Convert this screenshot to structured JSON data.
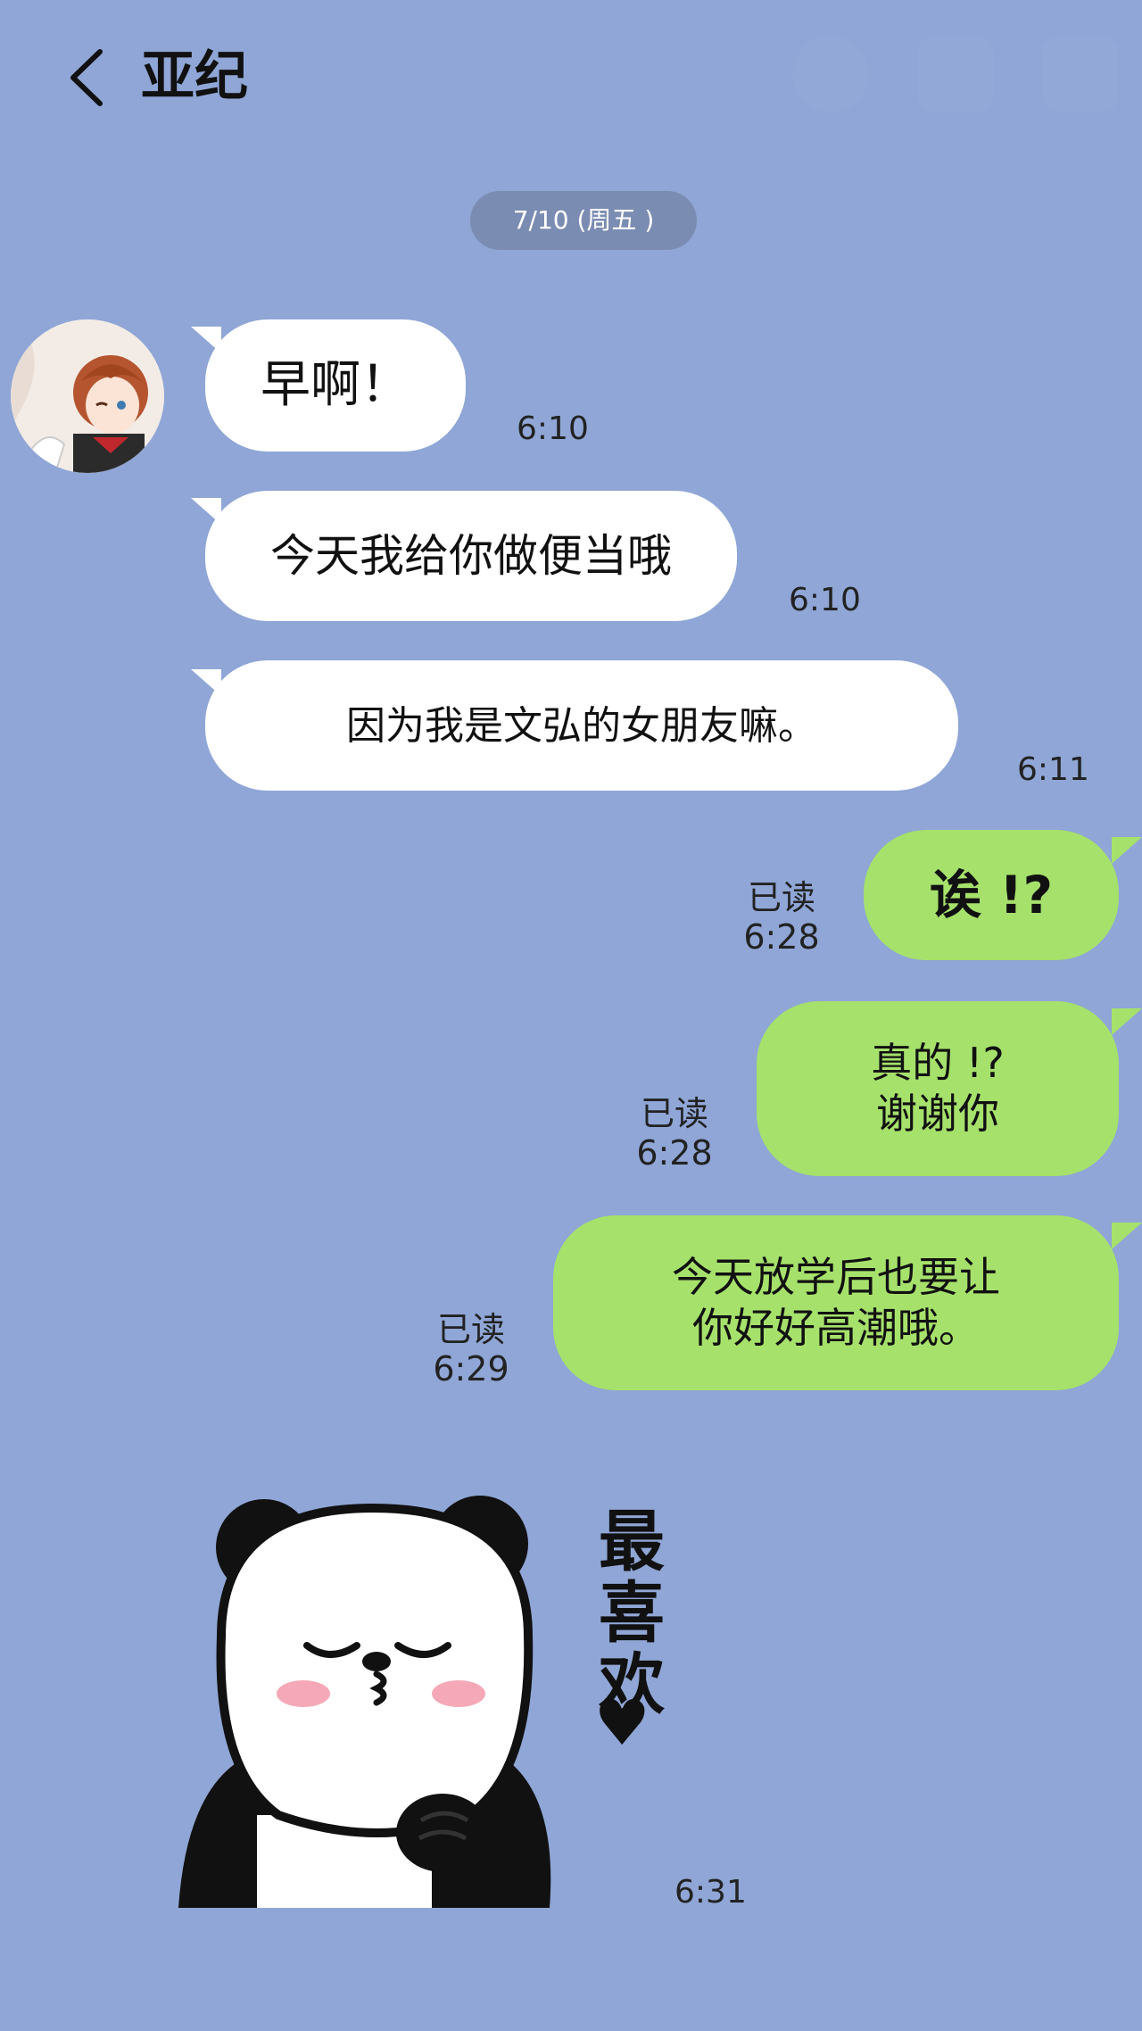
{
  "header": {
    "back_icon": "chevron-left-icon",
    "contact_name": "亚纪",
    "icons": [
      "search-icon",
      "phone-icon",
      "menu-icon"
    ]
  },
  "date_divider": "7/10 (周五 )",
  "messages": [
    {
      "side": "left",
      "text": "早啊！",
      "time": "6:10"
    },
    {
      "side": "left",
      "text": "今天我给你做便当哦",
      "time": "6:10"
    },
    {
      "side": "left",
      "text": "因为我是文弘的女朋友嘛。",
      "time": "6:11"
    },
    {
      "side": "right",
      "text": "诶 !?",
      "read": "已读",
      "time": "6:28"
    },
    {
      "side": "right",
      "line1": "真的 !?",
      "line2": "谢谢你",
      "read": "已读",
      "time": "6:28"
    },
    {
      "side": "right",
      "line1": "今天放学后也要让",
      "line2": "你好好高潮哦。",
      "read": "已读",
      "time": "6:29"
    }
  ],
  "sticker": {
    "icon": "panda-sticker-icon",
    "text": "最喜欢",
    "heart": "♥",
    "time": "6:31"
  },
  "colors": {
    "background": "#8fa6d6",
    "bubble_in": "#ffffff",
    "bubble_out": "#a6e16c",
    "date_pill": "#7b8cb2"
  }
}
